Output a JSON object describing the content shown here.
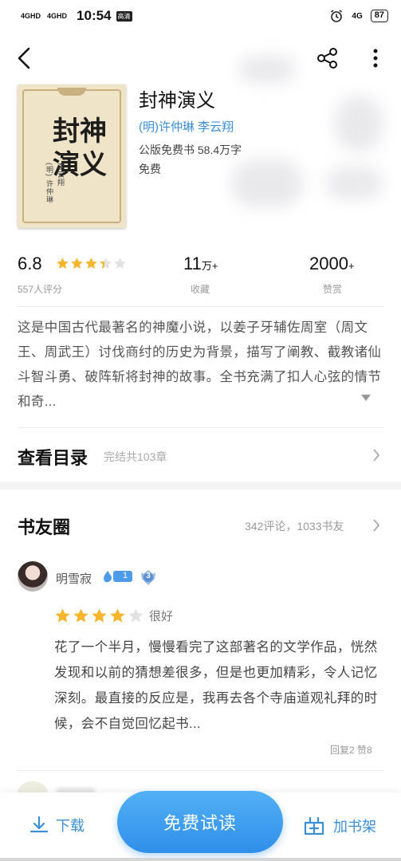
{
  "status_bar": {
    "signal1": "4GHD",
    "signal2": "4GHD",
    "time": "10:54",
    "hd_badge": "高清",
    "network": "4G",
    "battery": "87"
  },
  "nav": {
    "back_icon": "chevron-left-icon",
    "share_icon": "share-icon",
    "more_icon": "more-vertical-icon"
  },
  "book": {
    "cover_title": "封神演义",
    "cover_author_1": "(明) 许仲琳",
    "cover_author_2": "李云翔",
    "title": "封神演义",
    "authors": "(明)许仲琳 李云翔",
    "meta": "公版免费书  58.4万字",
    "price": "免费"
  },
  "stats": {
    "score": "6.8",
    "score_fraction": 0.68,
    "ratings_count": "557人评分",
    "collect_value": "11",
    "collect_unit": "万+",
    "collect_label": "收藏",
    "reward_value": "2000",
    "reward_unit": "+",
    "reward_label": "赞赏"
  },
  "description": "这是中国古代最著名的神魔小说，以姜子牙辅佐周室（周文王、周武王）讨伐商纣的历史为背景，描写了阐教、截教诸仙斗智斗勇、破阵斩将封神的故事。全书充满了扣人心弦的情节和奇...",
  "toc": {
    "title": "查看目录",
    "subtitle": "完结共103章"
  },
  "circle": {
    "title": "书友圈",
    "meta": "342评论，1033书友",
    "review": {
      "username": "明雪寂",
      "level": "1",
      "badge_level": "3",
      "stars": 4,
      "rating_text": "很好",
      "text": "花了一个半月，慢慢看完了这部著名的文学作品，恍然发现和以前的猜想差很多，但是也更加精彩，令人记忆深刻。最直接的反应是，我再去各个寺庙道观礼拜的时候，会不自觉回忆起书...",
      "footer": "回复2  赞8"
    }
  },
  "bottom": {
    "download_label": "下载",
    "read_label": "免费试读",
    "shelf_label": "加书架"
  },
  "colors": {
    "accent": "#3b8fd5",
    "star": "#f7b52c",
    "button_gradient_top": "#52b0f5",
    "button_gradient_bottom": "#2f8fe9"
  }
}
